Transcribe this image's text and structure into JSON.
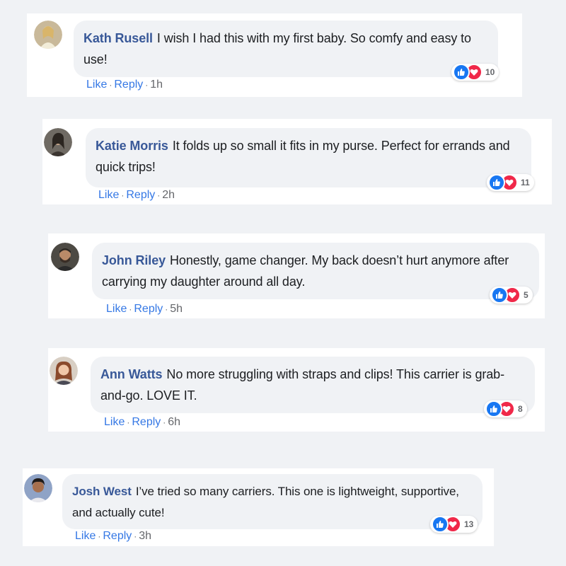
{
  "colors": {
    "page_bg": "#f0f2f5",
    "author_blue": "#385898",
    "link_blue": "#3578e5",
    "like_blue": "#1877f2",
    "love_red": "#f02849"
  },
  "comments": [
    {
      "author": "Kath Rusell",
      "text": "I wish I had this with my first baby. So comfy and easy to use!",
      "like_label": "Like",
      "reply_label": "Reply",
      "sep": "·",
      "time": "1h",
      "reaction_count": "10",
      "reaction_icons": [
        "like-icon",
        "love-icon"
      ]
    },
    {
      "author": "Katie Morris",
      "text": "It folds up so small it fits in my purse. Perfect for errands and quick trips!",
      "like_label": "Like",
      "reply_label": "Reply",
      "sep": "·",
      "time": "2h",
      "reaction_count": "11",
      "reaction_icons": [
        "like-icon",
        "love-icon"
      ]
    },
    {
      "author": "John Riley",
      "text": "Honestly, game changer. My back doesn’t hurt anymore after carrying my daughter around all day.",
      "like_label": "Like",
      "reply_label": "Reply",
      "sep": "·",
      "time": "5h",
      "reaction_count": "5",
      "reaction_icons": [
        "like-icon",
        "love-icon"
      ]
    },
    {
      "author": "Ann Watts",
      "text": "No more struggling with straps and clips! This carrier is grab-and-go. LOVE IT.",
      "like_label": "Like",
      "reply_label": "Reply",
      "sep": "·",
      "time": "6h",
      "reaction_count": "8",
      "reaction_icons": [
        "like-icon",
        "love-icon"
      ]
    },
    {
      "author": "Josh West",
      "text": "I’ve tried so many carriers. This one is lightweight, supportive, and actually cute!",
      "like_label": "Like",
      "reply_label": "Reply",
      "sep": "·",
      "time": "3h",
      "reaction_count": "13",
      "reaction_icons": [
        "like-icon",
        "love-icon"
      ]
    }
  ]
}
